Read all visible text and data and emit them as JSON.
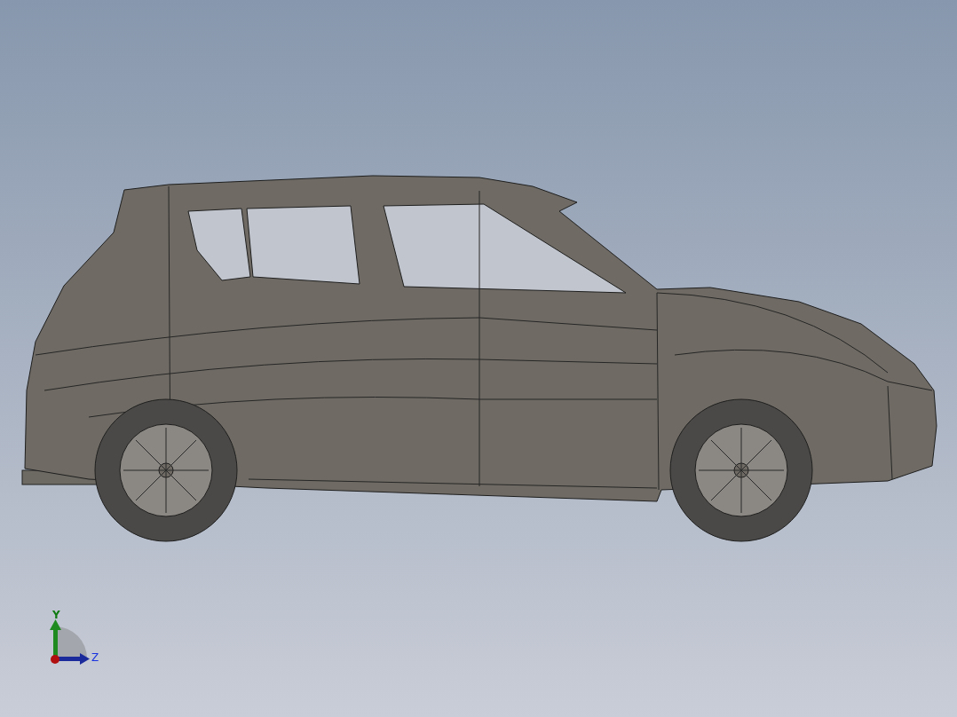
{
  "viewport": {
    "axis_triad": {
      "y_label": "Y",
      "z_label": "Z"
    }
  }
}
